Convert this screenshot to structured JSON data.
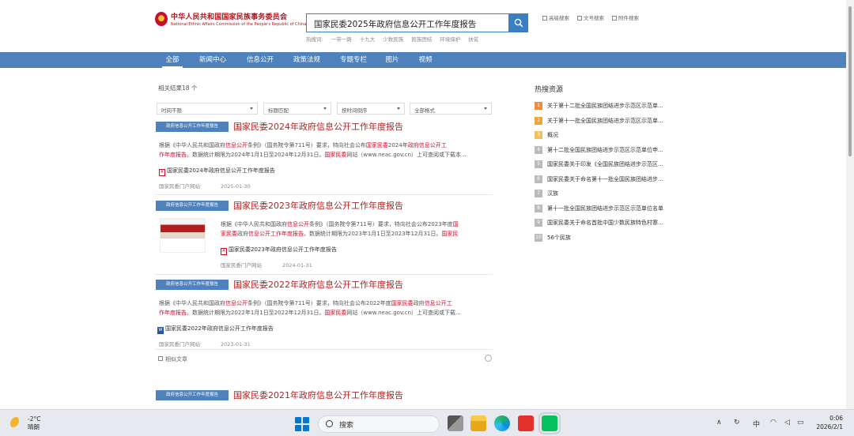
{
  "header": {
    "logo_cn": "中华人民共和国国家民族事务委员会",
    "logo_en": "National Ethnic Affairs Commission of the People's Republic of China",
    "search_query": "国家民委2025年政府信息公开工作年度报告",
    "hot_words_label": "热搜词:",
    "hot_words": [
      "一带一路",
      "十九大",
      "少数民族",
      "民族团结",
      "环境保护",
      "扶贫"
    ],
    "top_links": [
      "高级搜索",
      "文号搜索",
      "附件搜索"
    ]
  },
  "nav": {
    "items": [
      "全部",
      "新闻中心",
      "信息公开",
      "政策法规",
      "专题专栏",
      "图片",
      "视频"
    ],
    "active_index": 0
  },
  "results_header": {
    "count": "相关结果18 个",
    "filters": [
      "时间不限",
      "标题匹配",
      "按时间倒序",
      "全部格式"
    ]
  },
  "results": [
    {
      "badge": "政府信息公开工作年度报告",
      "title": "国家民委2024年政府信息公开工作年度报告",
      "line1": [
        {
          "t": "根据《中华人民共和国政府",
          "r": false
        },
        {
          "t": "信息公开",
          "r": true
        },
        {
          "t": "条例》（国务院令第711号）要求，特向社会公布",
          "r": false
        },
        {
          "t": "国家民委",
          "r": true
        },
        {
          "t": "2024年",
          "r": false
        },
        {
          "t": "政府信息公开工",
          "r": true
        }
      ],
      "line2": [
        {
          "t": "作年度报告",
          "r": true
        },
        {
          "t": "。数据统计期限为2024年1月1日至2024年12月31日。",
          "r": false
        },
        {
          "t": "国家民委",
          "r": true
        },
        {
          "t": "网站（www.neac.gov.cn）上可查阅或下载本...",
          "r": false
        }
      ],
      "attachment": "国家民委2024年政府信息公开工作年度报告",
      "source": "国家民委门户网站",
      "date": "2025-01-30"
    },
    {
      "badge": "政府信息公开工作年度报告",
      "title": "国家民委2023年政府信息公开工作年度报告",
      "line1": [
        {
          "t": "根据《中华人民共和国政府",
          "r": false
        },
        {
          "t": "信息公开",
          "r": true
        },
        {
          "t": "条例》（国务院令第711号）要求，特向社会公布2023年度",
          "r": false
        },
        {
          "t": "国",
          "r": true
        }
      ],
      "line2": [
        {
          "t": "家民委",
          "r": true
        },
        {
          "t": "政府",
          "r": false
        },
        {
          "t": "信息公开工作年度报告",
          "r": true
        },
        {
          "t": "。数据统计期限为2023年1月1日至2023年12月31日。",
          "r": false
        },
        {
          "t": "国家民",
          "r": true
        }
      ],
      "attachment": "国家民委2023年政府信息公开工作年度报告",
      "source": "国家民委门户网站",
      "date": "2024-01-31"
    },
    {
      "badge": "政府信息公开工作年度报告",
      "title": "国家民委2022年政府信息公开工作年度报告",
      "line1": [
        {
          "t": "根据《中华人民共和国政府",
          "r": false
        },
        {
          "t": "信息公开",
          "r": true
        },
        {
          "t": "条例》（国务院令第711号）要求，特向社会公布2022年度",
          "r": false
        },
        {
          "t": "国家民委",
          "r": true
        },
        {
          "t": "政府",
          "r": false
        },
        {
          "t": "信息公开工",
          "r": true
        }
      ],
      "line2": [
        {
          "t": "作年度报告",
          "r": true
        },
        {
          "t": "。数据统计期限为2022年1月1日至2022年12月31日。",
          "r": false
        },
        {
          "t": "国家民委",
          "r": true
        },
        {
          "t": "网站（www.neac.gov.cn）上可查阅或下载...",
          "r": false
        }
      ],
      "attachment": "国家民委2022年政府信息公开工作年度报告",
      "source": "国家民委门户网站",
      "date": "2023-01-31"
    },
    {
      "badge": "政府信息公开工作年度报告",
      "title": "国家民委2021年政府信息公开工作年度报告"
    }
  ],
  "similar_articles": "相似文章",
  "hot_resources": {
    "title": "热搜资源",
    "items": [
      "关于第十二批全国民族团结进步示范区示范单...",
      "关于第十一批全国民族团结进步示范区示范单...",
      "概况",
      "第十二批全国民族团结进步示范区示范单位申...",
      "国家民委关于印发《全国民族团结进步示范区...",
      "国家民委关于命名第十一批全国民族团结进步...",
      "汉族",
      "第十一批全国民族团结进步示范区示范单位名单",
      "国家民委关于命名首批中国少数民族特色村寨...",
      "56个民族"
    ]
  },
  "taskbar": {
    "temperature": "-2°C",
    "weather": "晴朗",
    "search_label": "搜索",
    "ime": "中",
    "time": "0:06",
    "date": "2026/2/1"
  },
  "colors": {
    "nav_blue": "#4f81bd",
    "title_red": "#b22222",
    "highlight_red": "#c8102e",
    "search_blue": "#3a7fc4"
  }
}
